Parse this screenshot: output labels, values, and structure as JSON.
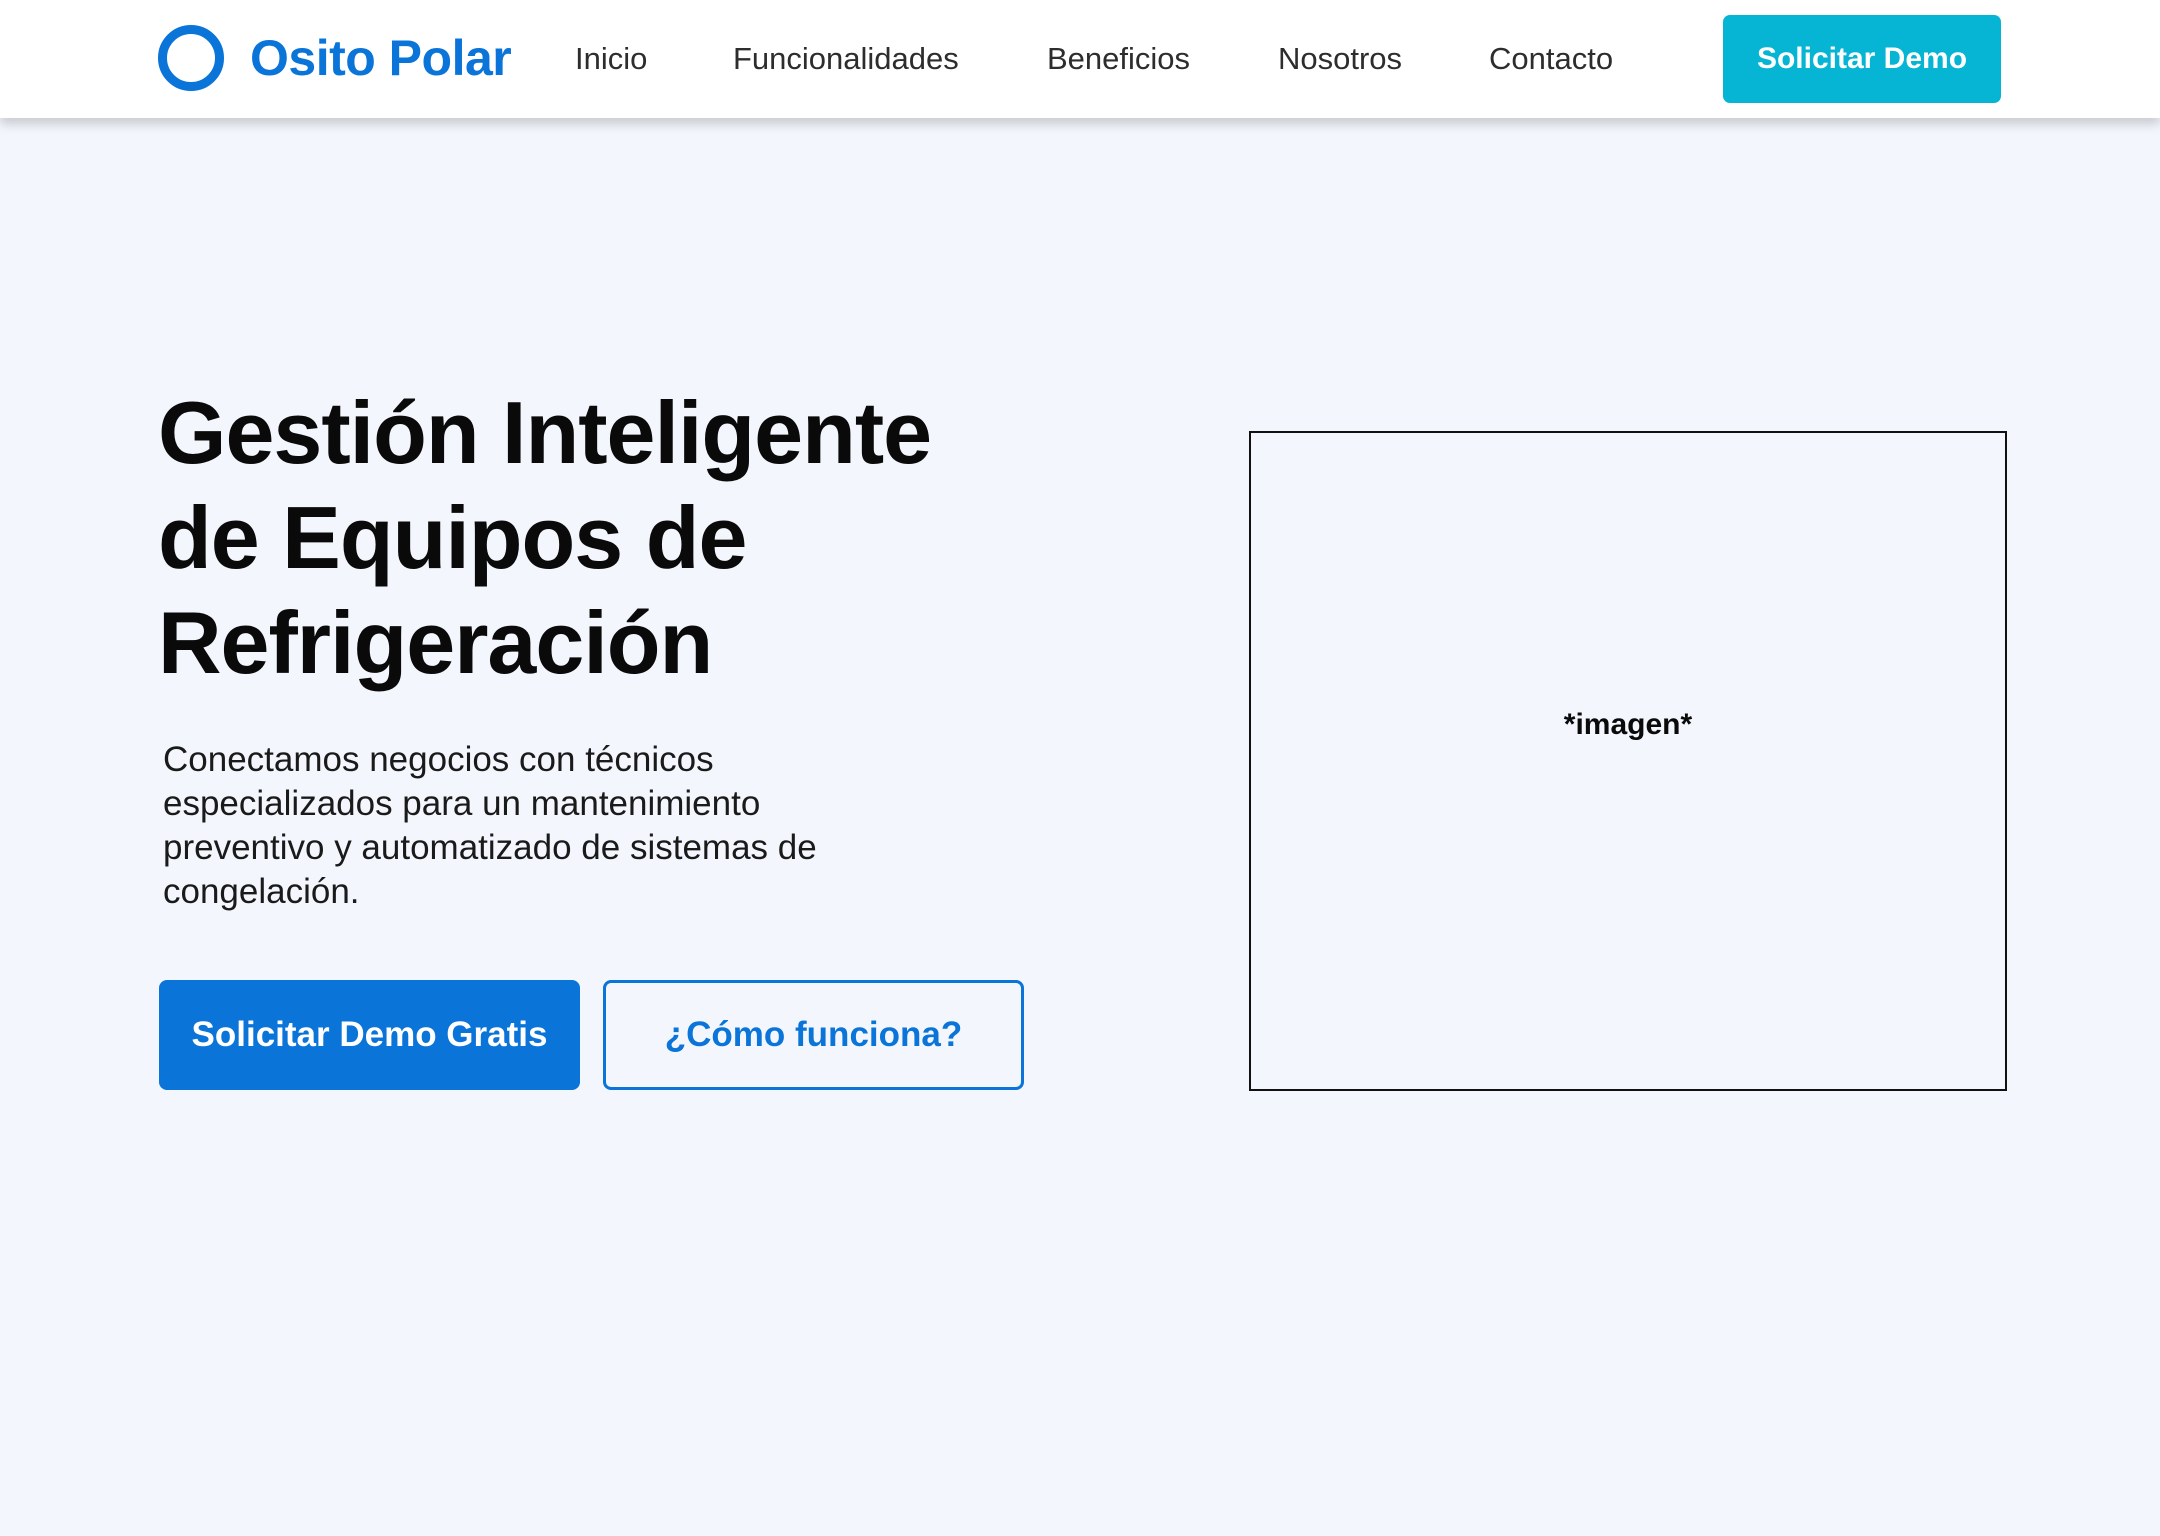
{
  "header": {
    "brand_name": "Osito Polar",
    "nav": {
      "inicio": "Inicio",
      "funcionalidades": "Funcionalidades",
      "beneficios": "Beneficios",
      "nosotros": "Nosotros",
      "contacto": "Contacto"
    },
    "cta_label": "Solicitar Demo"
  },
  "hero": {
    "title": "Gestión Inteligente de Equipos de Refrigeración",
    "description": "Conectamos negocios con técnicos especializados para un mantenimiento preventivo y automatizado de sistemas de congelación.",
    "primary_button": "Solicitar Demo Gratis",
    "secondary_button": "¿Cómo funciona?",
    "image_placeholder": "*imagen*"
  },
  "colors": {
    "brand_blue": "#0a74d8",
    "accent_cyan": "#05b5d3",
    "page_background": "#f3f7fd",
    "header_background": "#ffffff"
  },
  "icons": {
    "logo": "ring-logo-icon"
  }
}
